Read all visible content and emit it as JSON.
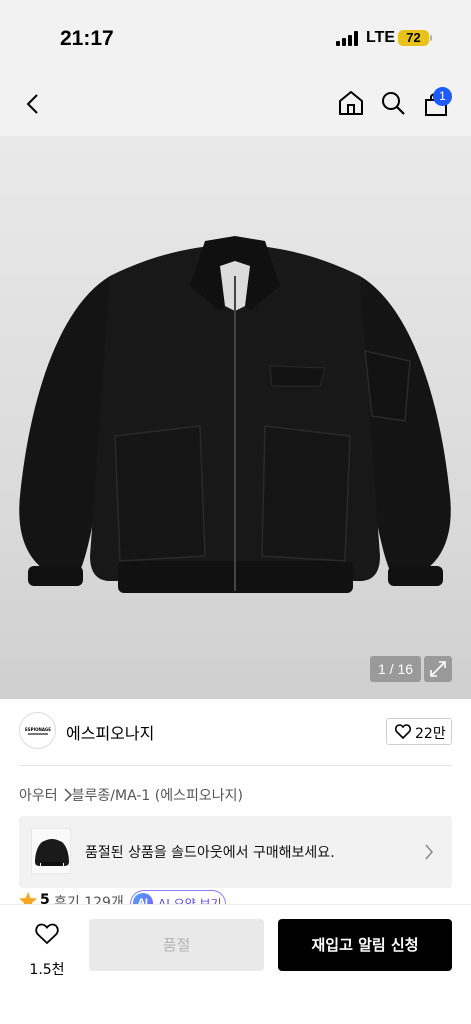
{
  "status_bar": {
    "time": "21:17",
    "network": "LTE",
    "battery": "72",
    "icons": [
      "signal-icon",
      "battery-icon"
    ]
  },
  "nav": {
    "icons": [
      "back-icon",
      "home-icon",
      "search-icon",
      "cart-icon"
    ],
    "cart_badge": "1"
  },
  "gallery": {
    "counter": "1 / 16",
    "icons": [
      "expand-icon"
    ]
  },
  "brand": {
    "name": "에스피오나지",
    "logo_text": "ESPIONAGE",
    "likes": "22만",
    "icons": [
      "heart-icon"
    ]
  },
  "breadcrumb": {
    "category": "아우터",
    "subcategory": "블루종/MA-1 (에스피오나지)",
    "icons": [
      "chevron-right-icon"
    ]
  },
  "soldout_banner": {
    "text": "품절된 상품을 솔드아웃에서 구매해보세요.",
    "icons": [
      "chevron-right-icon"
    ]
  },
  "reviews": {
    "rating": "5",
    "count_text": "후기 129개",
    "ai_badge": "AI",
    "ai_label": "AI 요약 보기",
    "icons": [
      "star-icon"
    ]
  },
  "bottom_bar": {
    "wish_count": "1.5천",
    "soldout_label": "품절",
    "restock_label": "재입고 알림 신청",
    "icons": [
      "heart-icon"
    ]
  },
  "colors": {
    "accent_blue": "#1e5cff",
    "battery_yellow": "#e8c21a",
    "ai_purple": "#5a47e6",
    "restock_button": "#000000"
  }
}
